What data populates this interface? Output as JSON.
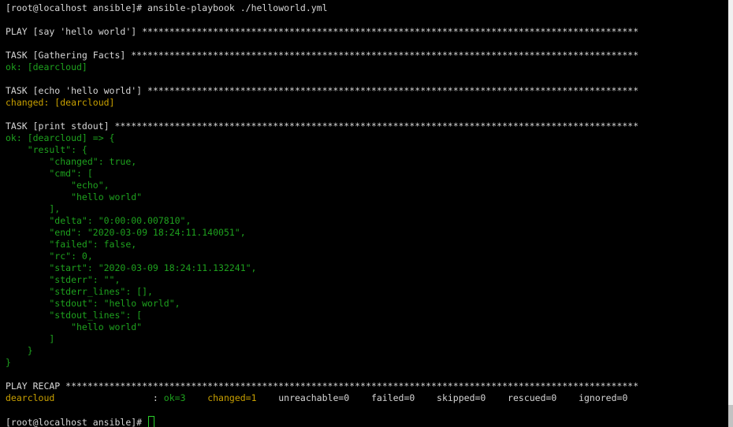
{
  "terminal": {
    "prompt": "[root@localhost ansible]#",
    "command": "ansible-playbook ./helloworld.yml",
    "play_header": "PLAY [say 'hello world'] *******************************************************************************************",
    "task1_header": "TASK [Gathering Facts] *********************************************************************************************",
    "task1_result": "ok: [dearcloud]",
    "task2_header": "TASK [echo 'hello world'] ******************************************************************************************",
    "task2_result": "changed: [dearcloud]",
    "task3_header": "TASK [print stdout] ************************************************************************************************",
    "task3_output": [
      "ok: [dearcloud] => {",
      "    \"result\": {",
      "        \"changed\": true,",
      "        \"cmd\": [",
      "            \"echo\",",
      "            \"hello world\"",
      "        ],",
      "        \"delta\": \"0:00:00.007810\",",
      "        \"end\": \"2020-03-09 18:24:11.140051\",",
      "        \"failed\": false,",
      "        \"rc\": 0,",
      "        \"start\": \"2020-03-09 18:24:11.132241\",",
      "        \"stderr\": \"\",",
      "        \"stderr_lines\": [],",
      "        \"stdout\": \"hello world\",",
      "        \"stdout_lines\": [",
      "            \"hello world\"",
      "        ]",
      "    }",
      "}"
    ],
    "recap_header": "PLAY RECAP *********************************************************************************************************",
    "recap": {
      "host": "dearcloud",
      "separator": "                  : ",
      "ok": "ok=3",
      "changed": "changed=1",
      "unreachable": "unreachable=0",
      "failed": "failed=0",
      "skipped": "skipped=0",
      "rescued": "rescued=0",
      "ignored": "ignored=0"
    },
    "final_prompt": "[root@localhost ansible]#"
  },
  "colors": {
    "background": "#000000",
    "default_text": "#d6d6d6",
    "ok_green": "#1ea11e",
    "changed_yellow": "#c8a000",
    "cursor_green": "#2ad02a"
  }
}
